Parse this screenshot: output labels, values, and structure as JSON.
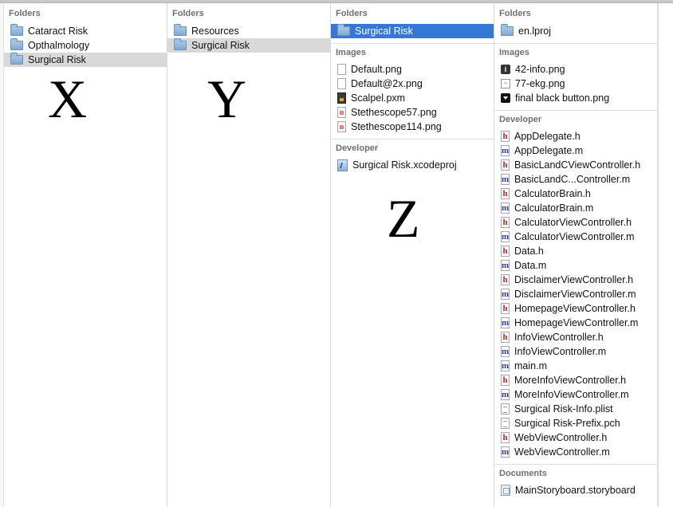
{
  "columns": [
    {
      "sections": [
        {
          "header": "Folders",
          "items": [
            {
              "label": "Cataract Risk",
              "icon": "folder-icon",
              "state": "normal"
            },
            {
              "label": "Opthalmology",
              "icon": "folder-icon",
              "state": "normal"
            },
            {
              "label": "Surgical Risk",
              "icon": "folder-icon",
              "state": "selected-gray"
            }
          ]
        }
      ],
      "overlay_letter": "X"
    },
    {
      "sections": [
        {
          "header": "Folders",
          "items": [
            {
              "label": "Resources",
              "icon": "folder-icon",
              "state": "normal"
            },
            {
              "label": "Surgical Risk",
              "icon": "folder-icon",
              "state": "selected-gray"
            }
          ]
        }
      ],
      "overlay_letter": "Y"
    },
    {
      "sections": [
        {
          "header": "Folders",
          "items": [
            {
              "label": "Surgical Risk",
              "icon": "folder-icon",
              "state": "selected-blue"
            }
          ]
        },
        {
          "header": "Images",
          "items": [
            {
              "label": "Default.png",
              "icon": "file-icon",
              "state": "normal"
            },
            {
              "label": "Default@2x.png",
              "icon": "file-icon",
              "state": "normal"
            },
            {
              "label": "Scalpel.pxm",
              "icon": "pxm-file-icon",
              "state": "normal"
            },
            {
              "label": "Stethescope57.png",
              "icon": "png-file-icon",
              "state": "normal"
            },
            {
              "label": "Stethescope114.png",
              "icon": "png-file-icon",
              "state": "normal"
            }
          ]
        },
        {
          "header": "Developer",
          "items": [
            {
              "label": "Surgical Risk.xcodeproj",
              "icon": "xcodeproj-icon",
              "state": "normal"
            }
          ]
        }
      ],
      "overlay_letter": "Z"
    },
    {
      "sections": [
        {
          "header": "Folders",
          "items": [
            {
              "label": "en.lproj",
              "icon": "folder-icon",
              "state": "normal"
            }
          ]
        },
        {
          "header": "Images",
          "items": [
            {
              "label": "42-info.png",
              "icon": "info-icon",
              "state": "normal"
            },
            {
              "label": "77-ekg.png",
              "icon": "ekg-icon",
              "state": "normal"
            },
            {
              "label": "final black button.png",
              "icon": "black-button-icon",
              "state": "normal"
            }
          ]
        },
        {
          "header": "Developer",
          "items": [
            {
              "label": "AppDelegate.h",
              "icon": "header-file-icon",
              "state": "normal"
            },
            {
              "label": "AppDelegate.m",
              "icon": "implementation-file-icon",
              "state": "normal"
            },
            {
              "label": "BasicLandCViewController.h",
              "icon": "header-file-icon",
              "state": "normal"
            },
            {
              "label": "BasicLandC...Controller.m",
              "icon": "implementation-file-icon",
              "state": "normal"
            },
            {
              "label": "CalculatorBrain.h",
              "icon": "header-file-icon",
              "state": "normal"
            },
            {
              "label": "CalculatorBrain.m",
              "icon": "implementation-file-icon",
              "state": "normal"
            },
            {
              "label": "CalculatorViewController.h",
              "icon": "header-file-icon",
              "state": "normal"
            },
            {
              "label": "CalculatorViewController.m",
              "icon": "implementation-file-icon",
              "state": "normal"
            },
            {
              "label": "Data.h",
              "icon": "header-file-icon",
              "state": "normal"
            },
            {
              "label": "Data.m",
              "icon": "implementation-file-icon",
              "state": "normal"
            },
            {
              "label": "DisclaimerViewController.h",
              "icon": "header-file-icon",
              "state": "normal"
            },
            {
              "label": "DisclaimerViewController.m",
              "icon": "implementation-file-icon",
              "state": "normal"
            },
            {
              "label": "HomepageViewController.h",
              "icon": "header-file-icon",
              "state": "normal"
            },
            {
              "label": "HomepageViewController.m",
              "icon": "implementation-file-icon",
              "state": "normal"
            },
            {
              "label": "InfoViewController.h",
              "icon": "header-file-icon",
              "state": "normal"
            },
            {
              "label": "InfoViewController.m",
              "icon": "implementation-file-icon",
              "state": "normal"
            },
            {
              "label": "main.m",
              "icon": "implementation-file-icon",
              "state": "normal"
            },
            {
              "label": "MoreInfoViewController.h",
              "icon": "header-file-icon",
              "state": "normal"
            },
            {
              "label": "MoreInfoViewController.m",
              "icon": "implementation-file-icon",
              "state": "normal"
            },
            {
              "label": "Surgical Risk-Info.plist",
              "icon": "plist-file-icon",
              "state": "normal"
            },
            {
              "label": "Surgical Risk-Prefix.pch",
              "icon": "pch-file-icon",
              "state": "normal"
            },
            {
              "label": "WebViewController.h",
              "icon": "header-file-icon",
              "state": "normal"
            },
            {
              "label": "WebViewController.m",
              "icon": "implementation-file-icon",
              "state": "normal"
            }
          ]
        },
        {
          "header": "Documents",
          "items": [
            {
              "label": "MainStoryboard.storyboard",
              "icon": "storyboard-icon",
              "state": "normal"
            }
          ]
        }
      ],
      "overlay_letter": ""
    }
  ],
  "colors": {
    "selection_blue": "#3477d4",
    "selection_gray": "#d9d9d9",
    "section_header_text": "#6b6f76",
    "header_file_h": "#b3262b",
    "implementation_file_m": "#2a3ea1"
  }
}
